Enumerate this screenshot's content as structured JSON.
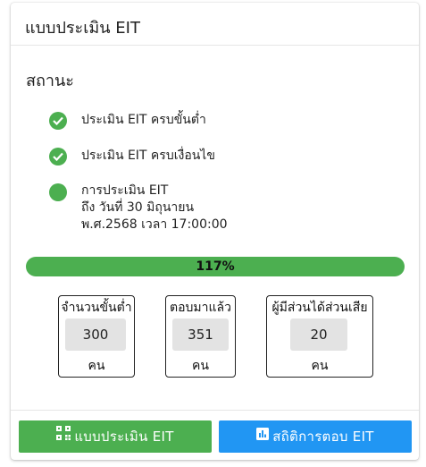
{
  "card": {
    "title": "แบบประเมิน EIT"
  },
  "status": {
    "title": "สถานะ",
    "conditions": [
      {
        "label": "ประเมิน EIT ครบขั้นต่ำ"
      },
      {
        "label": "ประเมิน EIT ครบเงื่อนไข"
      },
      {
        "line1": "การประเมิน EIT",
        "line2": "ถึง วันที่ 30 มิถุนายน",
        "line3": "พ.ศ.2568 เวลา 17:00:00"
      }
    ]
  },
  "progress": {
    "label": "117%",
    "percent": 117
  },
  "stats": [
    {
      "label": "จำนวนขั้นต่ำ",
      "value": "300",
      "unit": "คน"
    },
    {
      "label": "ตอบมาแล้ว",
      "value": "351",
      "unit": "คน"
    },
    {
      "label": "ผู้มีส่วนได้ส่วนเสีย",
      "value": "20",
      "unit": "คน"
    }
  ],
  "buttons": {
    "assess": {
      "label": "แบบประเมิน EIT",
      "icon": "qr-code-icon"
    },
    "stats": {
      "label": "สถิติการตอบ EIT",
      "icon": "bar-chart-icon"
    }
  },
  "colors": {
    "success": "#4caf50",
    "primary": "#2196f3"
  }
}
